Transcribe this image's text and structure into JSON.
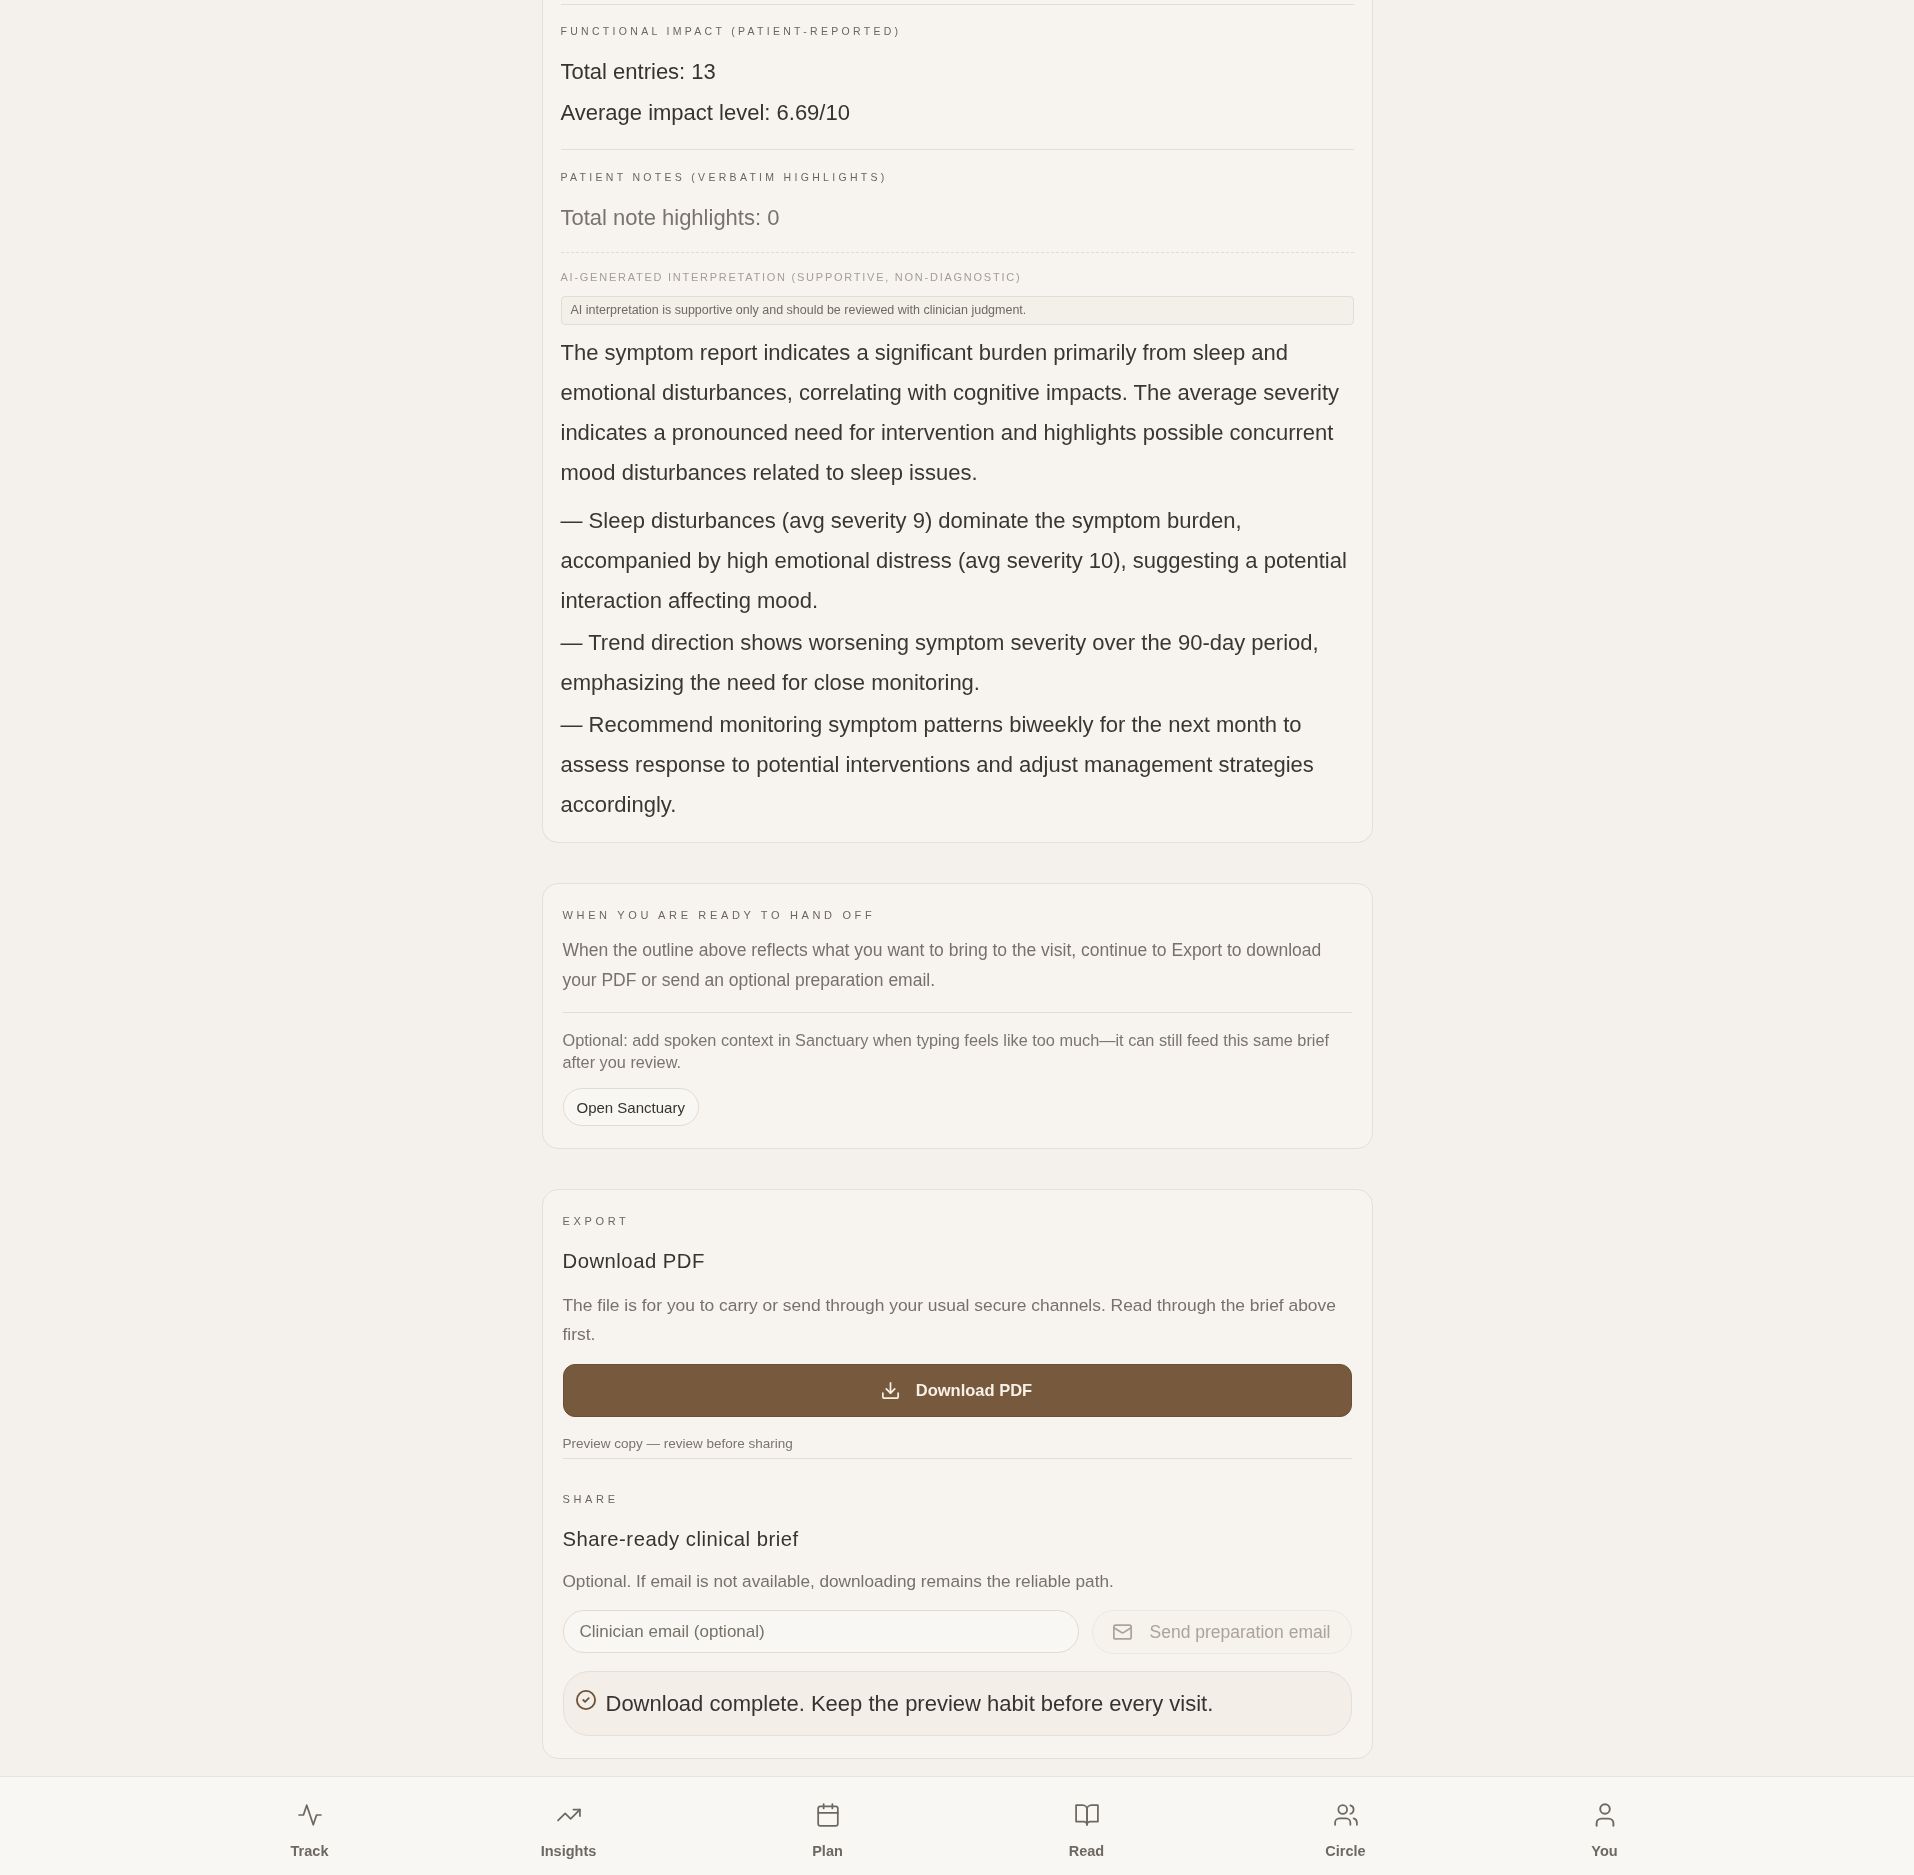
{
  "report_card": {
    "sections": [
      {
        "kind": "stats",
        "label": "FUNCTIONAL IMPACT (PATIENT-REPORTED)",
        "lines": [
          "Total entries: 13",
          "Average impact level: 6.69/10"
        ]
      },
      {
        "kind": "notes",
        "label": "PATIENT NOTES (VERBATIM HIGHLIGHTS)",
        "lines": [
          "Total note highlights: 0"
        ]
      },
      {
        "kind": "interpretation",
        "label": "AI-GENERATED INTERPRETATION (SUPPORTIVE, NON-DIAGNOSTIC)",
        "disclaimer": "AI interpretation is supportive only and should be reviewed with clinician judgment.",
        "summary": "The symptom report indicates a significant burden primarily from sleep and emotional disturbances, correlating with cognitive impacts. The average severity indicates a pronounced need for intervention and highlights possible concurrent mood disturbances related to sleep issues.",
        "points": [
          "— Sleep disturbances (avg severity 9) dominate the symptom burden, accompanied by high emotional distress (avg severity 10), suggesting a potential interaction affecting mood.",
          "— Trend direction shows worsening symptom severity over the 90-day period, emphasizing the need for close monitoring.",
          "— Recommend monitoring symptom patterns biweekly for the next month to assess response to potential interventions and adjust management strategies accordingly."
        ]
      }
    ]
  },
  "handoff_card": {
    "label": "WHEN YOU ARE READY TO HAND OFF",
    "text": "When the outline above reflects what you want to bring to the visit, continue to Export to download your PDF or send an optional preparation email.",
    "note": "Optional: add spoken context in Sanctuary when typing feels like too much—it can still feed this same brief after you review.",
    "button": "Open Sanctuary"
  },
  "export_card": {
    "export": {
      "label": "EXPORT",
      "title": "Download PDF",
      "text": "The file is for you to carry or send through your usual secure channels. Read through the brief above first.",
      "button": "Download PDF",
      "caption": "Preview copy — review before sharing"
    },
    "share": {
      "label": "SHARE",
      "title": "Share-ready clinical brief",
      "text": "Optional. If email is not available, downloading remains the reliable path.",
      "email_field": {
        "placeholder": "Clinician email (optional)"
      },
      "send_button": {
        "label": "Send preparation email",
        "disabled": true
      },
      "status": {
        "text": "Download complete. Keep the preview habit before every visit."
      }
    }
  },
  "bottom_nav": {
    "items": [
      {
        "label": "Track"
      },
      {
        "label": "Insights"
      },
      {
        "label": "Plan"
      },
      {
        "label": "Read"
      },
      {
        "label": "Circle"
      },
      {
        "label": "You"
      }
    ]
  }
}
